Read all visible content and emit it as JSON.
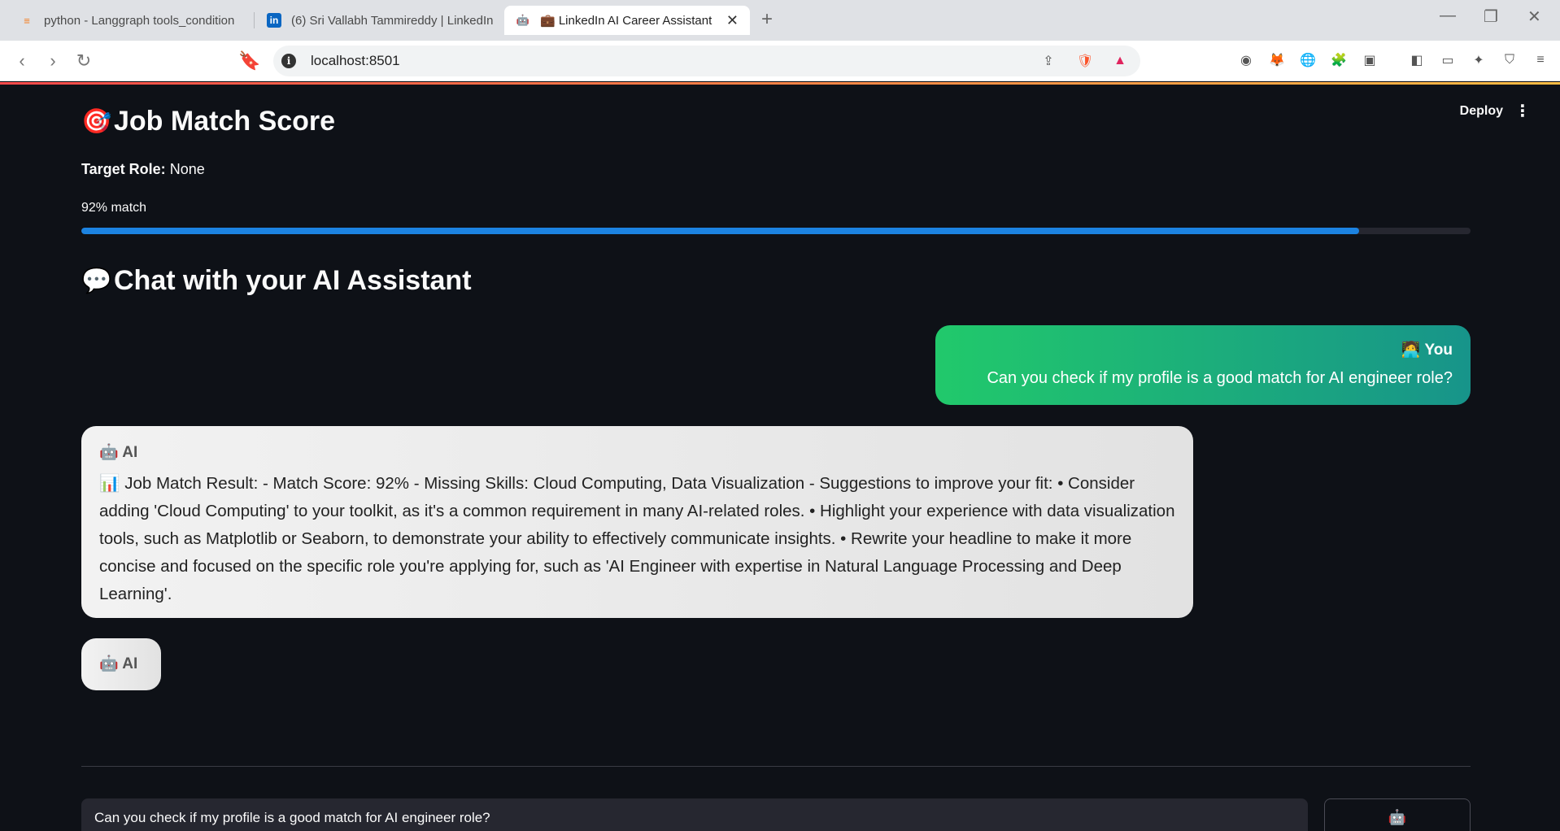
{
  "browser": {
    "tabs": [
      {
        "title": "python - Langgraph tools_condition",
        "favicon": "stackoverflow-icon"
      },
      {
        "title": "(6) Sri Vallabh Tammireddy | LinkedIn",
        "favicon": "linkedin-icon"
      },
      {
        "title": "💼 LinkedIn AI Career Assistant",
        "favicon": "robot-icon",
        "active": true
      }
    ],
    "url": "localhost:8501",
    "notification_badge": "1"
  },
  "app": {
    "deploy_label": "Deploy",
    "job_match": {
      "icon": "🎯",
      "title": "Job Match Score",
      "target_role_label": "Target Role:",
      "target_role_value": "None",
      "match_text": "92% match",
      "match_fraction": 0.92
    },
    "chat": {
      "icon": "💬",
      "title": "Chat with your AI Assistant",
      "messages": [
        {
          "role": "user",
          "sender_icon": "🧑‍💻",
          "sender": "You",
          "text": "Can you check if my profile is a good match for AI engineer role?"
        },
        {
          "role": "ai",
          "sender_icon": "🤖",
          "sender": "AI",
          "text": "📊 Job Match Result: - Match Score: 92% - Missing Skills: Cloud Computing, Data Visualization - Suggestions to improve your fit: • Consider adding 'Cloud Computing' to your toolkit, as it's a common requirement in many AI-related roles. • Highlight your experience with data visualization tools, such as Matplotlib or Seaborn, to demonstrate your ability to effectively communicate insights. • Rewrite your headline to make it more concise and focused on the specific role you're applying for, such as 'AI Engineer with expertise in Natural Language Processing and Deep Learning'."
        },
        {
          "role": "ai",
          "sender_icon": "🤖",
          "sender": "AI",
          "text": ""
        }
      ],
      "input_value": "Can you check if my profile is a good match for AI engineer role?",
      "send_icon": "🤖"
    }
  }
}
